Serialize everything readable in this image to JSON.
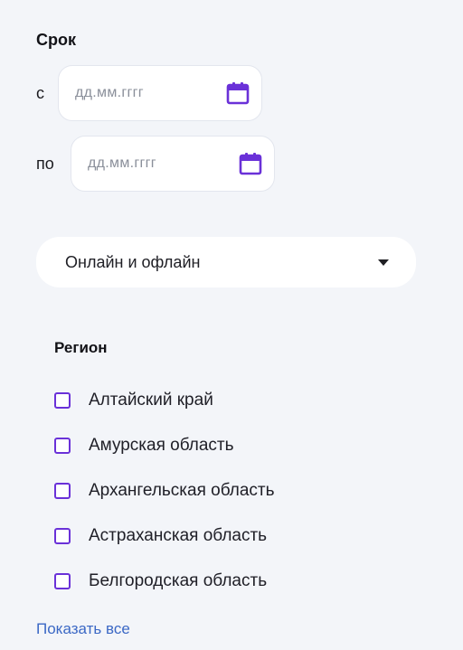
{
  "term": {
    "title": "Срок",
    "from_label": "с",
    "to_label": "по",
    "from_placeholder": "дд.мм.гггг",
    "to_placeholder": "дд.мм.гггг",
    "icon": "calendar-icon"
  },
  "mode": {
    "selected": "Онлайн и офлайн",
    "icon": "chevron-down-icon"
  },
  "region": {
    "title": "Регион",
    "items": [
      {
        "label": "Алтайский край",
        "checked": false
      },
      {
        "label": "Амурская область",
        "checked": false
      },
      {
        "label": "Архангельская область",
        "checked": false
      },
      {
        "label": "Астраханская область",
        "checked": false
      },
      {
        "label": "Белгородская область",
        "checked": false
      }
    ],
    "show_all": "Показать все"
  },
  "colors": {
    "accent": "#6a31d8",
    "link": "#3b68c5",
    "background": "#f3f5f9"
  }
}
